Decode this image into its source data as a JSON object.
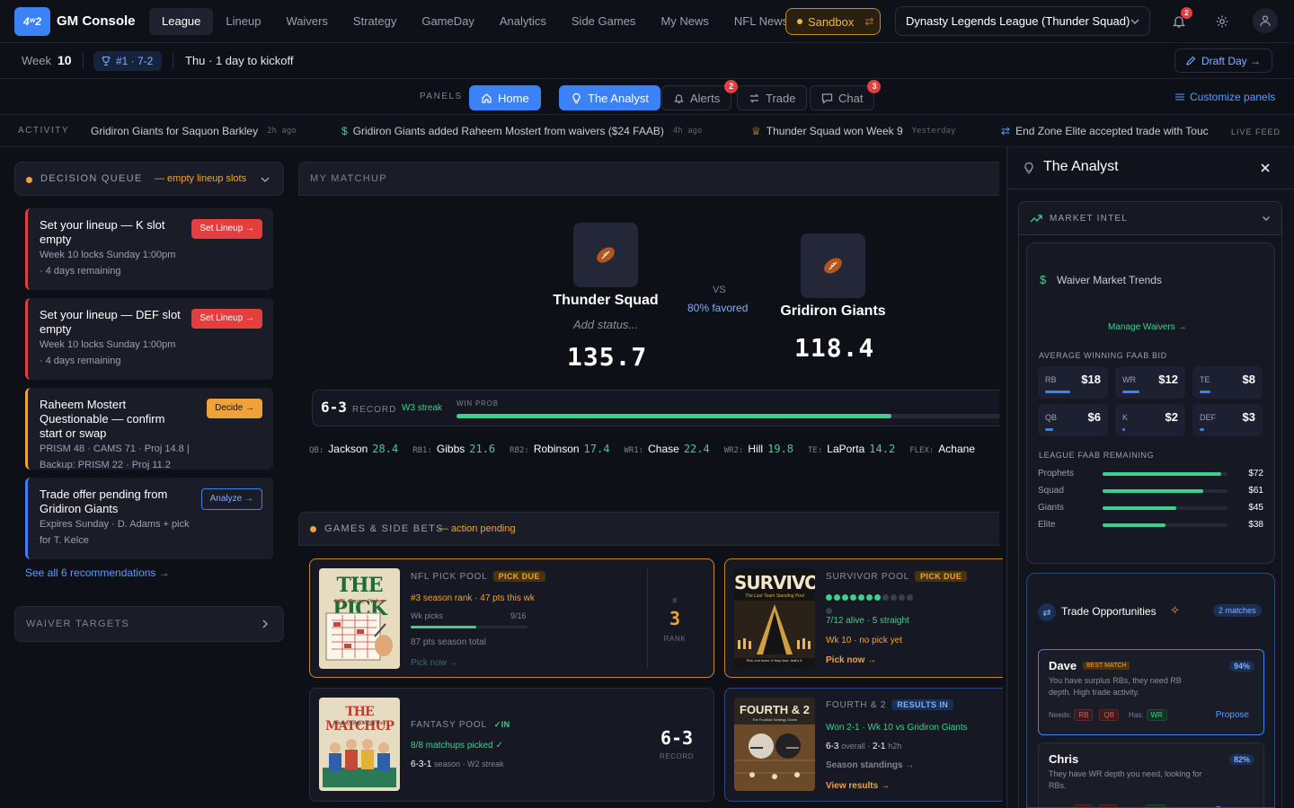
{
  "app": {
    "logo_text": "4ʷ2",
    "brand": "GM Console",
    "nav": [
      "League",
      "Lineup",
      "Waivers",
      "Strategy",
      "GameDay",
      "Analytics",
      "Side Games",
      "My News",
      "NFL News"
    ],
    "sandbox_label": "Sandbox",
    "league_selector": "Dynasty Legends League (Thunder Squad)",
    "notifications_count": "2"
  },
  "weekbar": {
    "week_label": "Week",
    "week_number": "10",
    "rank": "#1 · 7-2",
    "kickoff": "Thu · 1 day to kickoff",
    "draft_day": "Draft Day →"
  },
  "panels": {
    "label": "PANELS",
    "home": "Home",
    "analyst": "The Analyst",
    "alerts": "Alerts",
    "alerts_count": "2",
    "trade": "Trade",
    "chat": "Chat",
    "chat_count": "3",
    "customize": "Customize panels"
  },
  "activity": {
    "label": "ACTIVITY",
    "items": [
      {
        "text": "Gridiron Giants for Saquon Barkley",
        "ago": "2h ago"
      },
      {
        "text": "Gridiron Giants added Raheem Mostert from waivers ($24 FAAB)",
        "ago": "4h ago"
      },
      {
        "text": "Thunder Squad won Week 9",
        "ago": "Yesterday"
      },
      {
        "text": "End Zone Elite accepted trade with Touc",
        "ago": ""
      }
    ],
    "live": "LIVE FEED"
  },
  "decision_queue": {
    "title": "DECISION QUEUE",
    "subtitle": "— empty lineup slots",
    "cards": [
      {
        "title": "Set your lineup — K slot empty",
        "lines": [
          "Week 10 locks Sunday 1:00pm",
          "· 4 days remaining"
        ],
        "button": "Set Lineup →",
        "accent": "#e53e3e"
      },
      {
        "title": "Set your lineup — DEF slot empty",
        "lines": [
          "Week 10 locks Sunday 1:00pm",
          "· 4 days remaining"
        ],
        "button": "Set Lineup →",
        "accent": "#e53e3e"
      },
      {
        "title": "Raheem Mostert Questionable — confirm start or swap",
        "lines": [
          "PRISM 48 · CAMS 71 · Proj 14.8 |",
          "Backup: PRISM 22 · Proj 11.2"
        ],
        "button": "Decide →",
        "accent": "#f0a23a"
      },
      {
        "title": "Trade offer pending from Gridiron Giants",
        "lines": [
          "Expires Sunday · D. Adams + pick",
          "for T. Kelce"
        ],
        "button": "Analyze →",
        "accent": "#3b82f6"
      }
    ],
    "see_all": "See all 6 recommendations →",
    "waiver_targets": "WAIVER TARGETS"
  },
  "matchup": {
    "header": "MY MATCHUP",
    "home": {
      "name": "Thunder Squad",
      "status": "Add status...",
      "score": "135.7"
    },
    "away": {
      "name": "Gridiron Giants",
      "score": "118.4"
    },
    "vs": "VS",
    "favored": "80% favored",
    "win_prob": 0.8,
    "record": "6-3",
    "record_label": "RECORD",
    "streak": "W3 streak",
    "win_prob_label": "WIN PROB",
    "lineup": [
      {
        "pos": "QB:",
        "name": "Jackson",
        "pts": "28.4"
      },
      {
        "pos": "RB1:",
        "name": "Gibbs",
        "pts": "21.6"
      },
      {
        "pos": "RB2:",
        "name": "Robinson",
        "pts": "17.4"
      },
      {
        "pos": "WR1:",
        "name": "Chase",
        "pts": "22.4"
      },
      {
        "pos": "WR2:",
        "name": "Hill",
        "pts": "19.8"
      },
      {
        "pos": "TE:",
        "name": "LaPorta",
        "pts": "14.2"
      },
      {
        "pos": "FLEX:",
        "name": "Achane",
        "pts": ""
      }
    ]
  },
  "games": {
    "header": "GAMES & SIDE BETS",
    "subtitle": "— action pending",
    "pick_pool": {
      "cover_title": "THE PICK",
      "cover_sub": "NFL Game Picker",
      "kicker": "NFL PICK POOL",
      "tag": "PICK DUE",
      "line1": "#3 season rank · 47 pts this wk",
      "progress_label": "Wk picks",
      "progress_value": "9/16",
      "progress": 0.5625,
      "line3": "87 pts season total",
      "cta": "Pick now →",
      "rank_hash": "#",
      "rank": "3",
      "rank_label": "RANK"
    },
    "survivor": {
      "cover_title": "SURVIVOR",
      "cover_sub": "The Last Team Standing Pool",
      "cover_foot": "Pick one team. If they lose, that's it.",
      "kicker": "SURVIVOR POOL",
      "tag": "PICK DUE",
      "alive": 7,
      "total": 12,
      "line1": "7/12 alive · 5 straight",
      "line2": "Wk 10 · no pick yet",
      "cta": "Pick now →"
    },
    "fantasy_pool": {
      "cover_title": "THE MATCHUP",
      "cover_sub": "Fantasy League Pick Pool",
      "kicker": "FANTASY POOL",
      "tag": "✓IN",
      "line1": "8/8 matchups picked ✓",
      "line2_a": "6-3-1",
      "line2_b": "season · W2 streak",
      "record": "6-3",
      "record_label": "RECORD"
    },
    "fourth": {
      "cover_title": "FOURTH & 2",
      "cover_sub": "The Football Strategy Game",
      "kicker": "FOURTH & 2",
      "tag": "RESULTS IN",
      "line1": "Won 2-1 · Wk 10 vs Gridiron Giants",
      "line2_a": "6-3",
      "line2_b": "overall ·",
      "line2_c": "2-1",
      "line2_d": "h2h",
      "link1": "Season standings →",
      "link2": "View results →"
    }
  },
  "analyst": {
    "title": "The Analyst",
    "market_intel": "MARKET INTEL",
    "waiver_title": "Waiver Market Trends",
    "manage": "Manage Waivers",
    "avg_label": "AVERAGE WINNING FAAB BID",
    "faab": [
      {
        "pos": "RB",
        "value": "$18",
        "amount": 18
      },
      {
        "pos": "WR",
        "value": "$12",
        "amount": 12
      },
      {
        "pos": "TE",
        "value": "$8",
        "amount": 8
      },
      {
        "pos": "QB",
        "value": "$6",
        "amount": 6
      },
      {
        "pos": "K",
        "value": "$2",
        "amount": 2
      },
      {
        "pos": "DEF",
        "value": "$3",
        "amount": 3
      }
    ],
    "league_label": "LEAGUE FAAB REMAINING",
    "league": [
      {
        "team": "Prophets",
        "value": "$72",
        "amount": 72
      },
      {
        "team": "Squad",
        "value": "$61",
        "amount": 61
      },
      {
        "team": "Giants",
        "value": "$45",
        "amount": 45
      },
      {
        "team": "Elite",
        "value": "$38",
        "amount": 38
      }
    ],
    "trade_title": "Trade Opportunities",
    "trade_count": "2 matches",
    "trades": [
      {
        "name": "Dave",
        "badge": "BEST MATCH",
        "pct": "94%",
        "desc": "You have surplus RBs, they need RB depth. High trade activity.",
        "needs_label": "Needs:",
        "needs": [
          "RB",
          "QB"
        ],
        "has_label": "Has:",
        "has": [
          "WR"
        ],
        "cta": "Propose"
      },
      {
        "name": "Chris",
        "badge": "",
        "pct": "82%",
        "desc": "They have WR depth you need, looking for RBs.",
        "needs_label": "Needs:",
        "needs": [
          "RB",
          "TE"
        ],
        "has_label": "Has:",
        "has": [
          "WR"
        ],
        "cta": "Propose"
      }
    ]
  }
}
